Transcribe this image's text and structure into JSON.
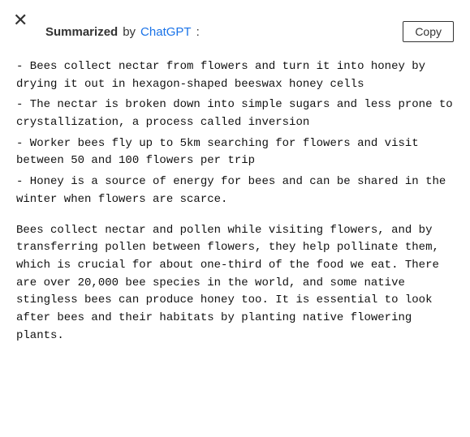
{
  "close_icon": "✕",
  "header": {
    "summarized_label": "Summarized",
    "by_text": "by",
    "chatgpt_link": "ChatGPT",
    "colon": ":",
    "copy_label": "Copy"
  },
  "bullets": [
    "- Bees collect nectar from flowers and turn it into honey by drying it out in hexagon-shaped beeswax honey cells",
    "- The nectar is broken down into simple sugars and less prone to crystallization, a process called inversion",
    "- Worker bees fly up to 5km searching for flowers and visit between 50 and 100 flowers per trip",
    "- Honey is a source of energy for bees and can be shared in the winter when flowers are scarce."
  ],
  "paragraph": " Bees collect nectar and pollen while visiting flowers, and by transferring pollen between flowers, they help pollinate them, which is crucial for about one-third of the food we eat. There are over 20,000 bee species in the world, and some native stingless bees can produce honey too. It is essential to look after bees and their habitats by planting native flowering plants."
}
